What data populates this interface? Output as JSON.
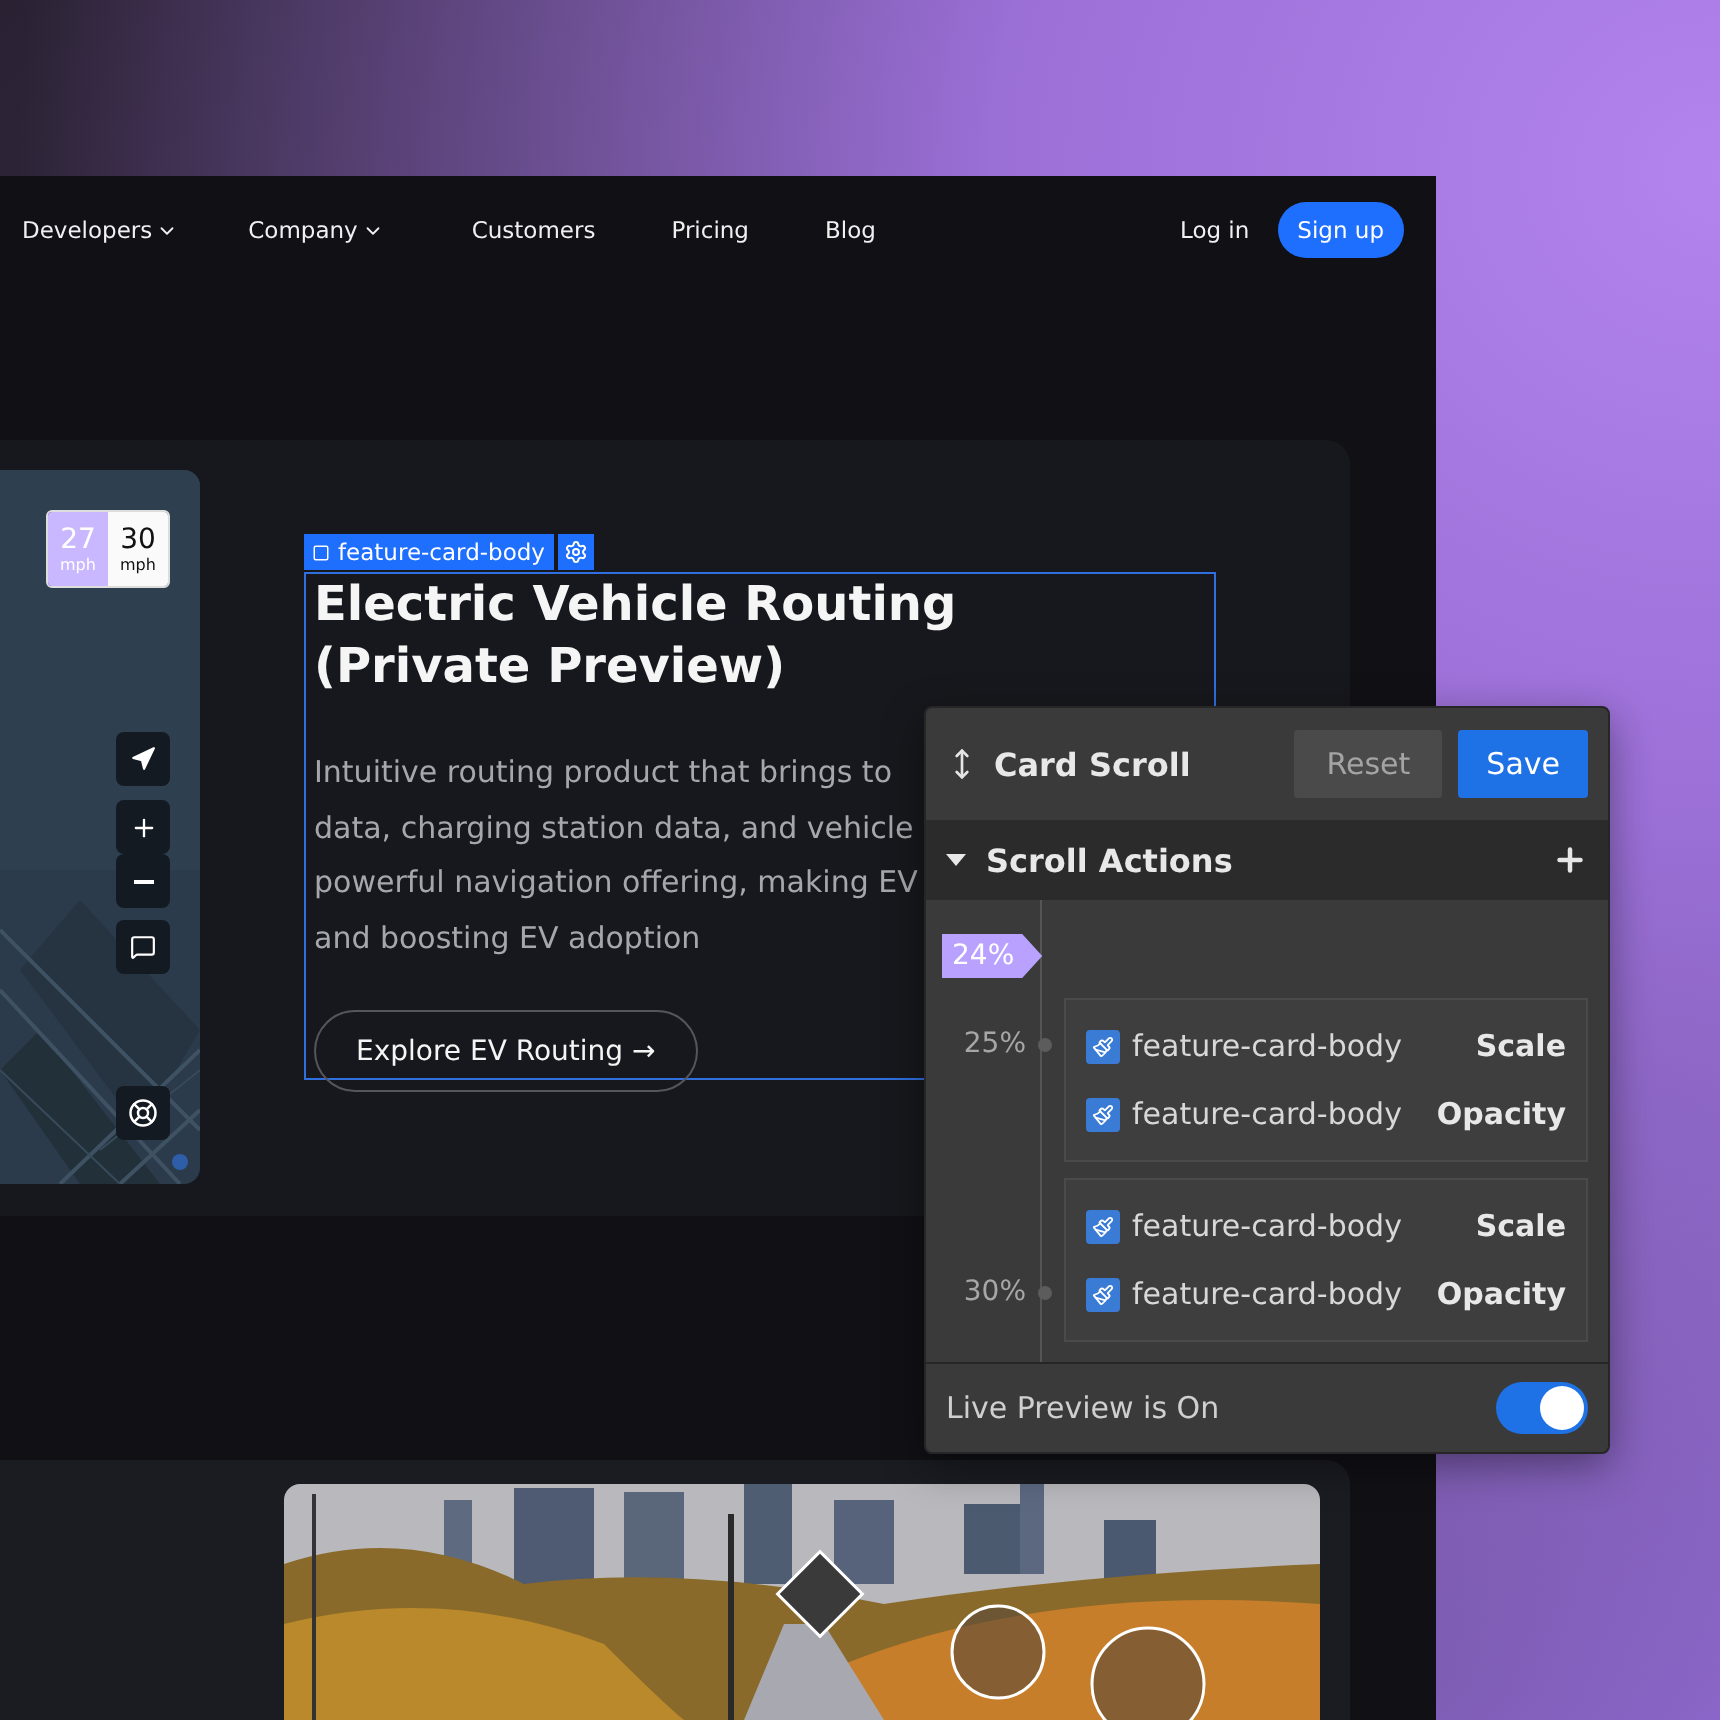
{
  "nav": {
    "items": [
      {
        "label": "Developers",
        "dropdown": true
      },
      {
        "label": "Company",
        "dropdown": true
      },
      {
        "label": "Customers",
        "dropdown": false
      },
      {
        "label": "Pricing",
        "dropdown": false
      },
      {
        "label": "Blog",
        "dropdown": false
      }
    ],
    "login": "Log in",
    "signup": "Sign up"
  },
  "map": {
    "speed": {
      "current": "27",
      "current_unit": "mph",
      "limit": "30",
      "limit_unit": "mph"
    }
  },
  "selection": {
    "label": "feature-card-body"
  },
  "card": {
    "title_lines": [
      "Electric Vehicle Routing",
      "(Private Preview)"
    ],
    "description_lines": [
      "Intuitive routing product that brings to",
      "data, charging station data, and vehicle",
      "powerful navigation offering, making EV",
      "and boosting EV adoption"
    ],
    "button": "Explore EV Routing →"
  },
  "panel": {
    "title": "Card Scroll",
    "reset": "Reset",
    "save": "Save",
    "section": {
      "title": "Scroll Actions",
      "expanded": true
    },
    "marker": "24%",
    "groups": [
      {
        "actions": [
          {
            "target": "feature-card-body",
            "action": "Scale",
            "checked": true,
            "percent": "25%"
          },
          {
            "target": "feature-card-body",
            "action": "Opacity",
            "checked": true
          }
        ]
      },
      {
        "actions": [
          {
            "target": "feature-card-body",
            "action": "Scale",
            "checked": true
          },
          {
            "target": "feature-card-body",
            "action": "Opacity",
            "checked": true,
            "percent": "30%"
          }
        ]
      }
    ],
    "live_preview": {
      "label": "Live Preview is On",
      "on": true
    }
  }
}
